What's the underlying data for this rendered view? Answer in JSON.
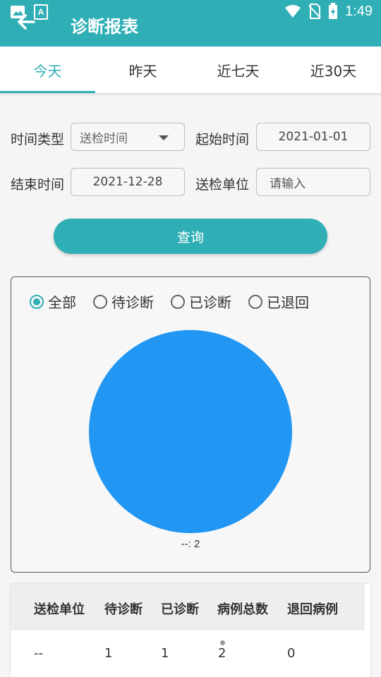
{
  "status_bar": {
    "time": "1:49",
    "icons": [
      "image-icon",
      "text-icon",
      "wifi-icon",
      "no-sim-icon",
      "battery-charging-icon"
    ]
  },
  "app_bar": {
    "title": "诊断报表",
    "back_icon": "arrow-back-icon"
  },
  "tabs": [
    {
      "label": "今天",
      "active": true
    },
    {
      "label": "昨天",
      "active": false
    },
    {
      "label": "近七天",
      "active": false
    },
    {
      "label": "近30天",
      "active": false
    }
  ],
  "filters": {
    "time_type_label": "时间类型",
    "time_type_value": "送检时间",
    "start_label": "起始时间",
    "start_value": "2021-01-01",
    "end_label": "结束时间",
    "end_value": "2021-12-28",
    "unit_label": "送检单位",
    "unit_placeholder": "请输入"
  },
  "query_button": "查询",
  "chart": {
    "radios": [
      {
        "label": "全部",
        "checked": true
      },
      {
        "label": "待诊断",
        "checked": false
      },
      {
        "label": "已诊断",
        "checked": false
      },
      {
        "label": "已退回",
        "checked": false
      }
    ]
  },
  "chart_data": {
    "type": "pie",
    "slices": [
      {
        "label": "--",
        "value": 2,
        "color": "#2196f3"
      }
    ],
    "slice_label": "--: 2"
  },
  "table": {
    "headers": [
      "送检单位",
      "待诊断",
      "已诊断",
      "病例总数",
      "退回病例"
    ],
    "rows": [
      [
        "--",
        "1",
        "1",
        "2",
        "0"
      ]
    ]
  },
  "colors": {
    "primary": "#2fafb5",
    "pie": "#2196f3"
  }
}
